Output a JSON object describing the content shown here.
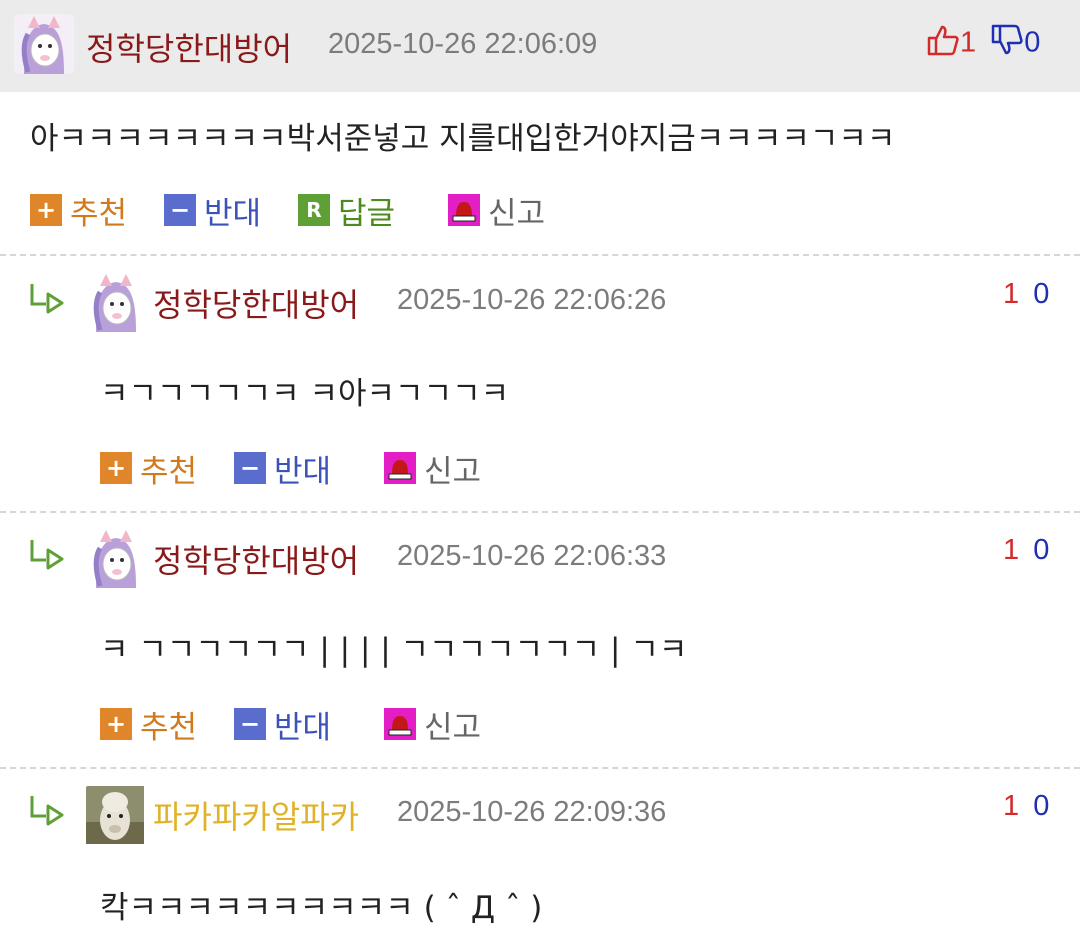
{
  "colors": {
    "nick": "#8a1a1a",
    "nick_alt": "#e0b227",
    "recommend": "#e0862a",
    "oppose": "#5a6ccc",
    "reply": "#5fa036",
    "report": "#e21ec4",
    "up": "#d22b2b",
    "down": "#1f2fb5"
  },
  "labels": {
    "recommend": "추천",
    "oppose": "반대",
    "reply": "답글",
    "report": "신고",
    "recommend_glyph": "+",
    "oppose_glyph": "−",
    "reply_glyph": "R"
  },
  "comments": [
    {
      "nick": "정학당한대방어",
      "date": "2025-10-26 22:06:09",
      "up": "1",
      "down": "0",
      "text": "아ㅋㅋㅋㅋㅋㅋㅋㅋ박서준넣고 지를대입한거야지금ㅋㅋㅋㅋㄱㅋㅋ"
    },
    {
      "nick": "정학당한대방어",
      "date": "2025-10-26 22:06:26",
      "up": "1",
      "down": "0",
      "text": "ㅋㄱㄱㄱㄱㄱㅋ ㅋ아ㅋㄱㄱㄱㅋ"
    },
    {
      "nick": "정학당한대방어",
      "date": "2025-10-26 22:06:33",
      "up": "1",
      "down": "0",
      "text": "ㅋ ㄱㄱㄱㄱㄱㄱ | | | | ㄱㄱㄱㄱㄱㄱㄱ | ㄱㅋ"
    },
    {
      "nick": "파카파카알파카",
      "date": "2025-10-26 22:09:36",
      "up": "1",
      "down": "0",
      "text": "칵ㅋㅋㅋㅋㅋㅋㅋㅋㅋㅋ ( ˆ Д ˆ )"
    }
  ]
}
